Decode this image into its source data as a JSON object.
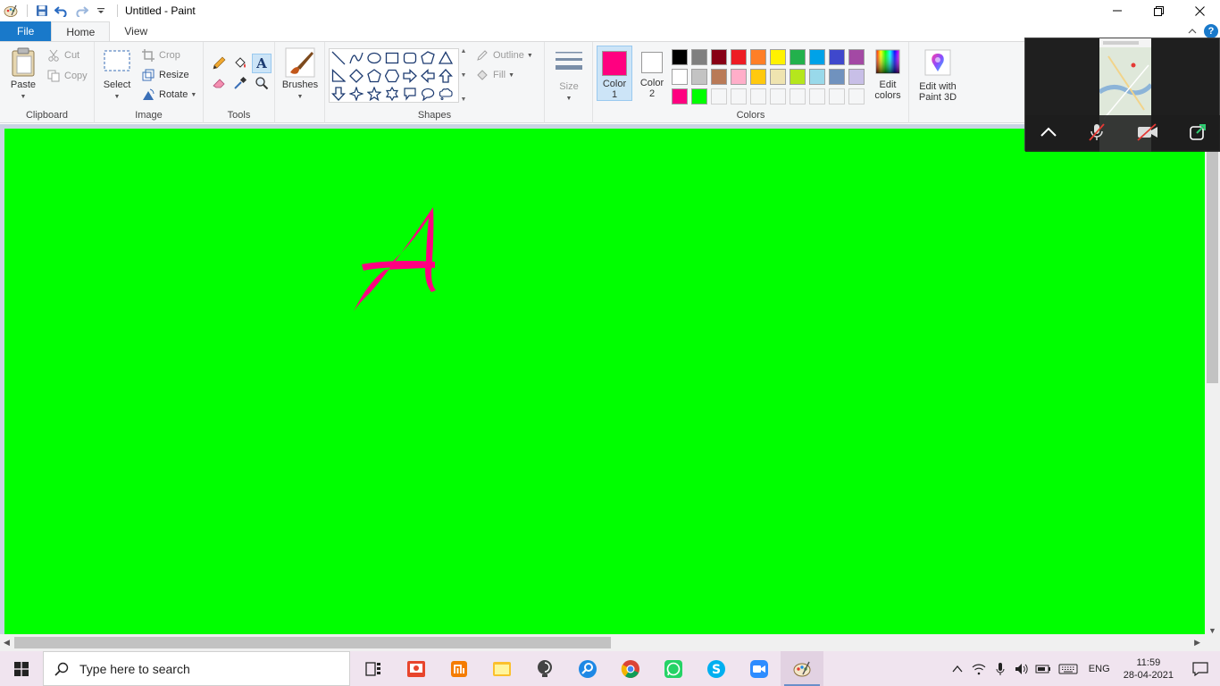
{
  "window": {
    "title": "Untitled - Paint",
    "controls": {
      "minimize": "—",
      "maximize": "❐",
      "close": "✕"
    }
  },
  "quick_access": [
    "paint-app-icon",
    "save-icon",
    "undo-icon",
    "redo-icon",
    "customize-qat-icon"
  ],
  "tabs": [
    {
      "label": "File"
    },
    {
      "label": "Home"
    },
    {
      "label": "View"
    }
  ],
  "ribbon": {
    "clipboard": {
      "paste": "Paste",
      "cut": "Cut",
      "copy": "Copy",
      "group": "Clipboard"
    },
    "image": {
      "select": "Select",
      "crop": "Crop",
      "resize": "Resize",
      "rotate": "Rotate",
      "group": "Image"
    },
    "tools": {
      "group": "Tools",
      "items": [
        "pencil-icon",
        "fill-icon",
        "text-icon",
        "eraser-icon",
        "color-picker-icon",
        "magnifier-icon"
      ]
    },
    "brushes": {
      "label": "Brushes"
    },
    "shapes": {
      "outline": "Outline",
      "fill": "Fill",
      "group": "Shapes"
    },
    "size": {
      "label": "Size"
    },
    "colors": {
      "color1": {
        "line1": "Color",
        "line2": "1",
        "value": "#ff0080"
      },
      "color2": {
        "line1": "Color",
        "line2": "2",
        "value": "#ffffff"
      },
      "edit_colors": {
        "line1": "Edit",
        "line2": "colors"
      },
      "group": "Colors",
      "palette": [
        "#000000",
        "#7f7f7f",
        "#880015",
        "#ed1c24",
        "#ff7f27",
        "#fff200",
        "#22b14c",
        "#00a2e8",
        "#3f48cc",
        "#a349a4",
        "#ffffff",
        "#c3c3c3",
        "#b97a57",
        "#ffaec9",
        "#ffc90e",
        "#efe4b0",
        "#b5e61d",
        "#99d9ea",
        "#7092be",
        "#c8bfe7",
        "#ff0080",
        "#00ff00",
        "",
        "",
        "",
        "",
        "",
        "",
        "",
        ""
      ]
    },
    "paint3d": {
      "line1": "Edit with",
      "line2": "Paint 3D"
    }
  },
  "canvas": {
    "background": "#00ff00",
    "drawn_letter": "A",
    "stroke_color": "#ff0080"
  },
  "taskbar": {
    "search_placeholder": "Type here to search",
    "apps": [
      "task-view-icon",
      "presentation-app-icon",
      "mi-app-icon",
      "sticky-notes-icon",
      "tips-icon",
      "search-tool-icon",
      "chrome-icon",
      "whatsapp-icon",
      "skype-icon",
      "zoom-icon",
      "paint-icon"
    ],
    "tray": {
      "language": "ENG",
      "time": "11:59",
      "date": "28-04-2021"
    }
  }
}
